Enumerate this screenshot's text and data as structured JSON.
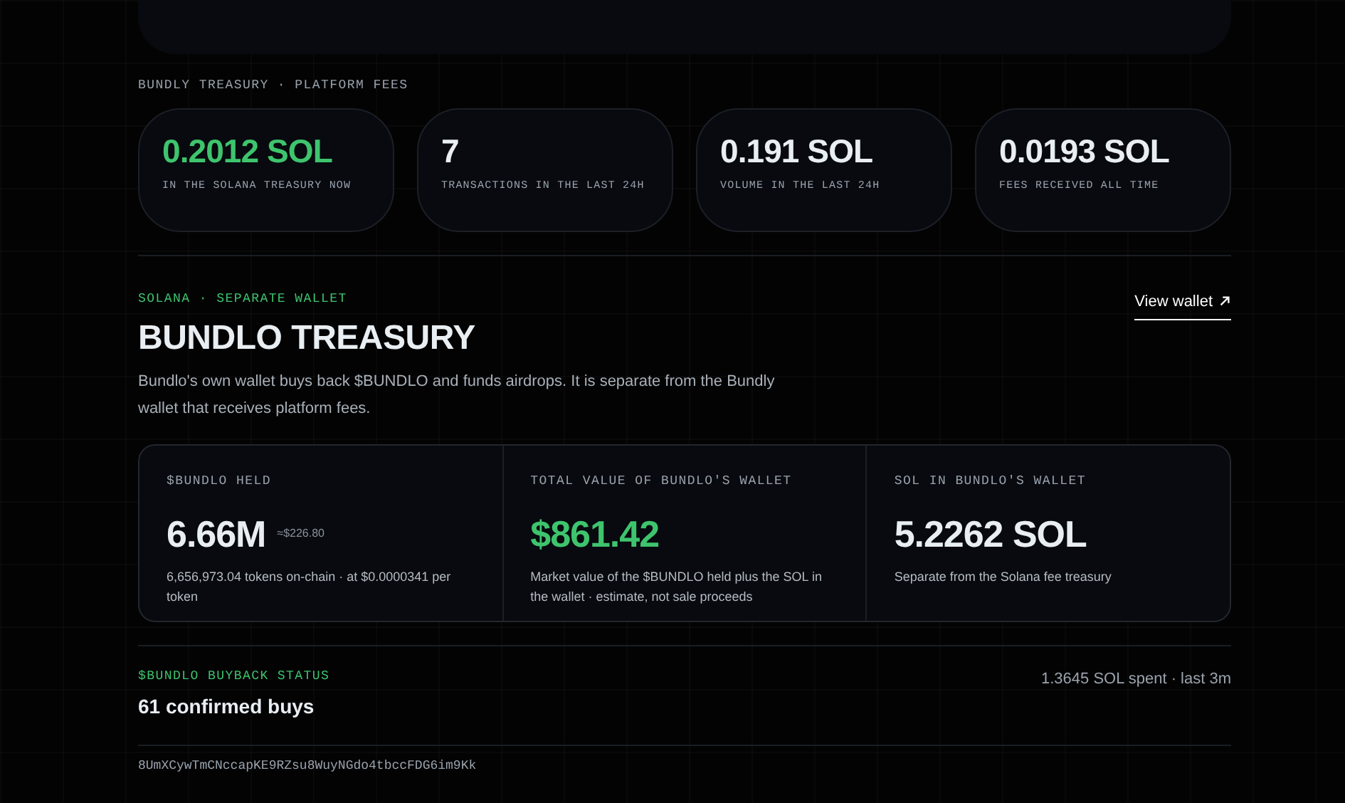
{
  "platform": {
    "label": "BUNDLY TREASURY · PLATFORM FEES",
    "stats": [
      {
        "value": "0.2012 SOL",
        "caption": "IN THE SOLANA TREASURY NOW",
        "accent": true
      },
      {
        "value": "7",
        "caption": "TRANSACTIONS IN THE LAST 24H",
        "accent": false
      },
      {
        "value": "0.191 SOL",
        "caption": "VOLUME IN THE LAST 24H",
        "accent": false
      },
      {
        "value": "0.0193 SOL",
        "caption": "FEES RECEIVED ALL TIME",
        "accent": false
      }
    ]
  },
  "treasury": {
    "eyebrow": "SOLANA · SEPARATE WALLET",
    "title": "BUNDLO TREASURY",
    "link": "View wallet",
    "description": "Bundlo's own wallet buys back $BUNDLO and funds airdrops. It is separate from the Bundly wallet that receives platform fees.",
    "cells": [
      {
        "label": "$BUNDLO HELD",
        "value": "6.66M",
        "aside": "≈$226.80",
        "note": "6,656,973.04 tokens on-chain · at $0.0000341 per token",
        "accent": false
      },
      {
        "label": "TOTAL VALUE OF BUNDLO'S WALLET",
        "value": "$861.42",
        "note": "Market value of the $BUNDLO held plus the SOL in the wallet · estimate, not sale proceeds",
        "accent": true
      },
      {
        "label": "SOL IN BUNDLO'S WALLET",
        "value": "5.2262 SOL",
        "note": "Separate from the Solana fee treasury",
        "accent": false
      }
    ]
  },
  "buyback": {
    "label": "$BUNDLO BUYBACK STATUS",
    "count": "61 confirmed buys",
    "spent": "1.3645 SOL spent · last 3m",
    "address": "8UmXCywTmCNccapKE9RZsu8WuyNGdo4tbccFDG6im9Kk"
  }
}
